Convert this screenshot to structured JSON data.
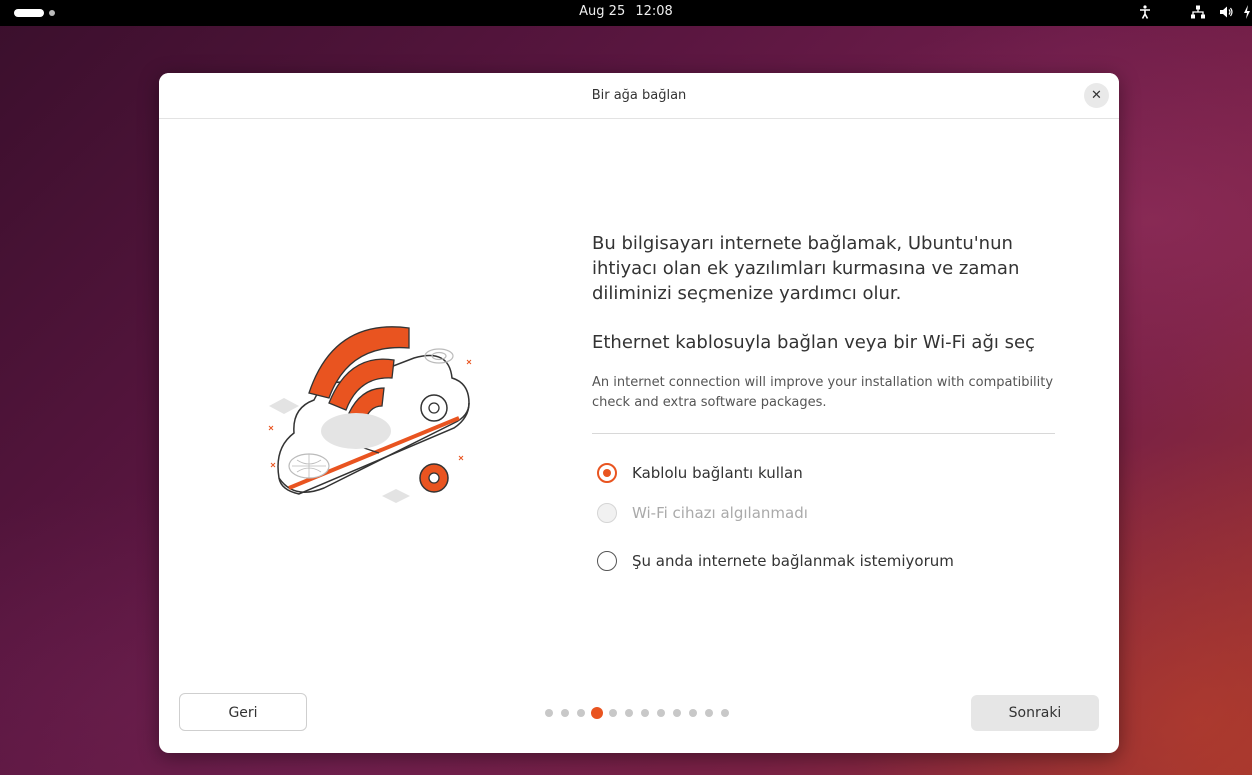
{
  "topbar": {
    "date": "Aug 25",
    "time": "12:08",
    "icons": [
      "accessibility-icon",
      "network-icon",
      "volume-icon",
      "power-icon"
    ]
  },
  "dialog": {
    "title": "Bir ağa bağlan",
    "close_label": "✕",
    "intro": "Bu bilgisayarı internete bağlamak, Ubuntu'nun ihtiyacı olan ek yazılımları kurmasına ve zaman diliminizi seçmenize yardımcı olur.",
    "subheading": "Ethernet kablosuyla bağlan veya bir Wi-Fi ağı seç",
    "note": "An internet connection will improve your installation with compatibility check and extra software packages.",
    "options": [
      {
        "label": "Kablolu bağlantı kullan",
        "state": "checked"
      },
      {
        "label": "Wi-Fi cihazı algılanmadı",
        "state": "disabled"
      },
      {
        "label": "Şu anda internete bağlanmak istemiyorum",
        "state": "unchecked"
      }
    ],
    "back_label": "Geri",
    "next_label": "Sonraki",
    "pager": {
      "total": 12,
      "current": 4
    }
  },
  "colors": {
    "accent": "#e95420",
    "topbar": "#000000",
    "dialog_bg": "#ffffff"
  }
}
